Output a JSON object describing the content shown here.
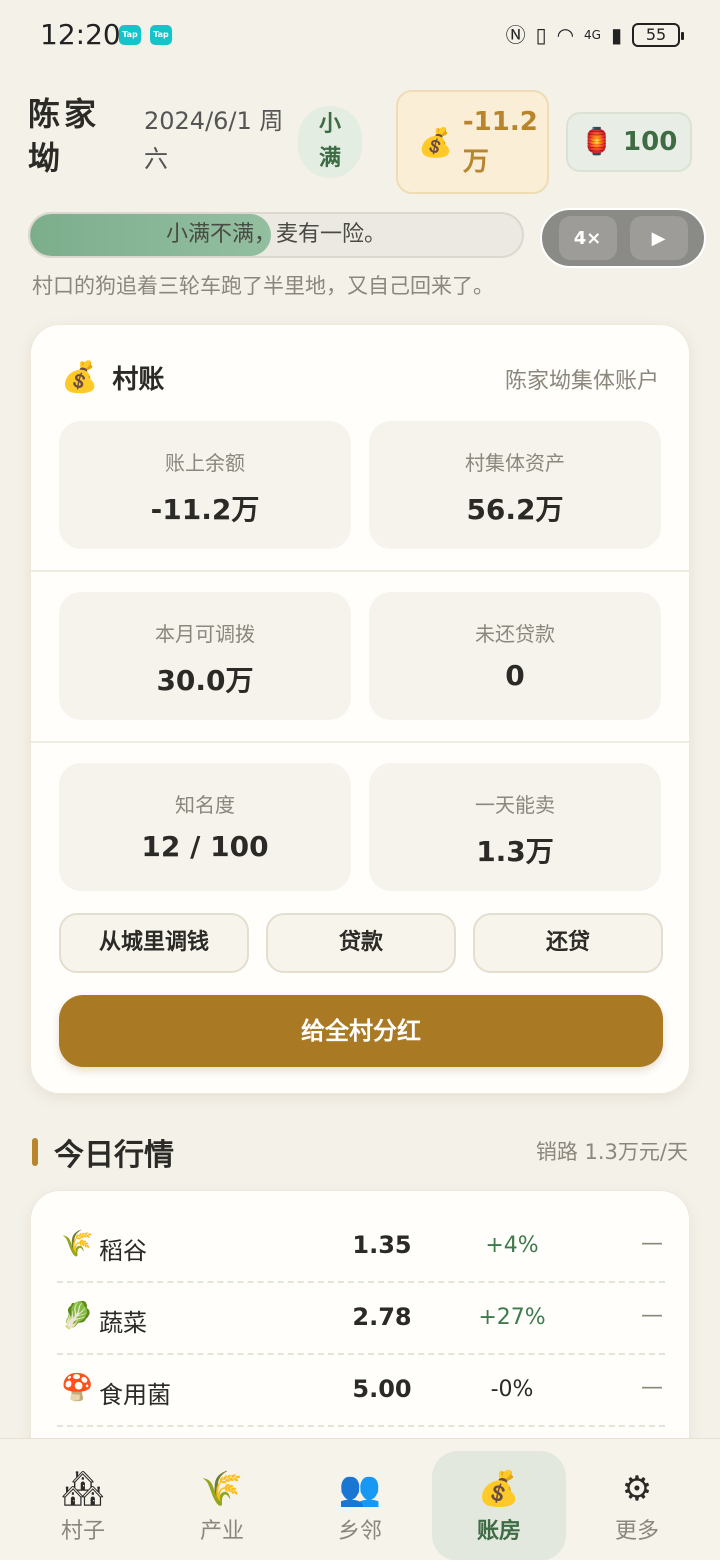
{
  "status_bar": {
    "time": "12:20",
    "app_badges": [
      "Tap",
      "Tap"
    ],
    "battery": "55",
    "signal": "4G"
  },
  "header": {
    "village_name": "陈家坳",
    "date": "2024/6/1 周六",
    "season": "小满",
    "money": "-11.2万",
    "lanterns": "100"
  },
  "progress": {
    "text": "小满不满，麦有一险。",
    "fraction": 0.49
  },
  "speed": {
    "multiplier": "4×",
    "second": "▶"
  },
  "tagline": "村口的狗追着三轮车跑了半里地，又自己回来了。",
  "ledger": {
    "title": "村账",
    "subtitle": "陈家坳集体账户",
    "stats": [
      {
        "label": "账上余额",
        "value": "-11.2万"
      },
      {
        "label": "村集体资产",
        "value": "56.2万"
      },
      {
        "label": "本月可调拨",
        "value": "30.0万"
      },
      {
        "label": "未还贷款",
        "value": "0"
      },
      {
        "label": "知名度",
        "value": "12 / 100"
      },
      {
        "label": "一天能卖",
        "value": "1.3万"
      }
    ],
    "buttons": [
      "从城里调钱",
      "贷款",
      "还贷"
    ],
    "primary_button": "给全村分红"
  },
  "market": {
    "title": "今日行情",
    "subtitle": "销路 1.3万元/天",
    "rows": [
      {
        "icon": "🌾",
        "name": "稻谷",
        "price": "1.35",
        "change": "+4%",
        "change_color": "#3f7a4d",
        "trend": "—"
      },
      {
        "icon": "🥬",
        "name": "蔬菜",
        "price": "2.78",
        "change": "+27%",
        "change_color": "#3f7a4d",
        "trend": "—"
      },
      {
        "icon": "🍄",
        "name": "食用菌",
        "price": "5.00",
        "change": "-0%",
        "change_color": "#2b2a26",
        "trend": "—"
      }
    ]
  },
  "nav": {
    "items": [
      {
        "icon": "🏘",
        "label": "村子"
      },
      {
        "icon": "🌾",
        "label": "产业"
      },
      {
        "icon": "👥",
        "label": "乡邻"
      },
      {
        "icon": "💰",
        "label": "账房"
      },
      {
        "icon": "⚙",
        "label": "更多"
      }
    ],
    "active": "账房"
  },
  "colors": {
    "accent": "#a97924",
    "green": "#3f6b45",
    "background": "#f4f1e9"
  }
}
